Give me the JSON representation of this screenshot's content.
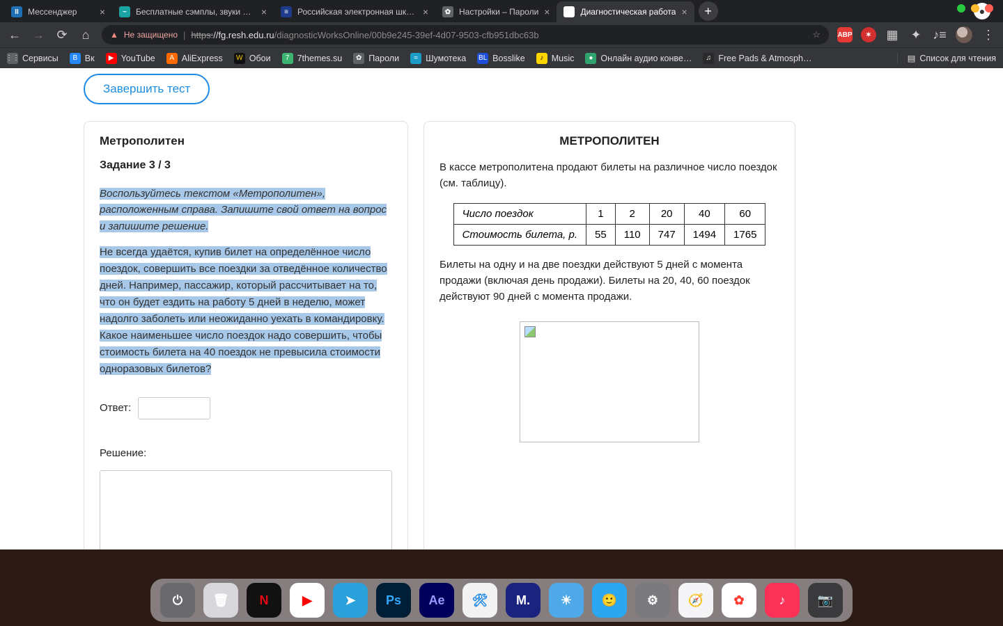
{
  "tabs": [
    {
      "title": "Мессенджер",
      "fav_bg": "#1f6fb5",
      "fav_txt": "II",
      "active": false
    },
    {
      "title": "Бесплатные сэмплы, звуки и лупы",
      "fav_bg": "#1aa3a3",
      "fav_txt": "~",
      "active": false
    },
    {
      "title": "Российская электронная школа",
      "fav_bg": "#1e3a8a",
      "fav_txt": "≡",
      "active": false
    },
    {
      "title": "Настройки – Пароли",
      "fav_bg": "#5f6368",
      "fav_txt": "✿",
      "active": false
    },
    {
      "title": "Диагностическая работа",
      "fav_bg": "#ffffff",
      "fav_txt": " ",
      "active": true
    }
  ],
  "omnibox": {
    "security_label": "Не защищено",
    "url_scheme": "https:",
    "url_domain": "//fg.resh.edu.ru",
    "url_path": "/diagnosticWorksOnline/00b9e245-39ef-4d07-9503-cfb951dbc63b"
  },
  "toolbar_ext": {
    "abp": "ABP"
  },
  "bookmarks": [
    {
      "label": "Сервисы",
      "bg": "#5f6368",
      "txt": "⋮⋮"
    },
    {
      "label": "Вк",
      "bg": "#2787f5",
      "txt": "B"
    },
    {
      "label": "YouTube",
      "bg": "#ff0000",
      "txt": "▶"
    },
    {
      "label": "AliExpress",
      "bg": "#ff6a00",
      "txt": "A"
    },
    {
      "label": "Обои",
      "bg": "#111",
      "txt": "W",
      "color": "#ffcc00"
    },
    {
      "label": "7themes.su",
      "bg": "#3cb371",
      "txt": "7"
    },
    {
      "label": "Пароли",
      "bg": "#5f6368",
      "txt": "✿"
    },
    {
      "label": "Шумотека",
      "bg": "#1a9cc7",
      "txt": "≈"
    },
    {
      "label": "Bosslike",
      "bg": "#1e4fd8",
      "txt": "BL"
    },
    {
      "label": "Music",
      "bg": "#ffd500",
      "txt": "♪",
      "color": "#000"
    },
    {
      "label": "Онлайн аудио конве…",
      "bg": "#30a46c",
      "txt": "●"
    },
    {
      "label": "Free Pads & Atmosph…",
      "bg": "#2a2a2a",
      "txt": "♫"
    }
  ],
  "reading_list": "Список для чтения",
  "page": {
    "finish": "Завершить тест",
    "left": {
      "title": "Метрополитен",
      "task": "Задание 3 / 3",
      "instruction": "Воспользуйтесь текстом «Метрополитен», расположенным справа. Запишите свой ответ на вопрос и запишите решение.",
      "para": "Не всегда удаётся, купив билет на определённое число поездок, совершить все поездки за отведённое количество дней. Например, пассажир, который рассчитывает на то, что он будет ездить на работу 5 дней в неделю, может надолго заболеть или неожиданно уехать в командировку.",
      "question": "Какое наименьшее число поездок надо совершить, чтобы стоимость билета на 40 поездок не превысила стоимости одноразовых билетов?",
      "answer_label": "Ответ:",
      "solution_label": "Решение:"
    },
    "right": {
      "title": "МЕТРОПОЛИТЕН",
      "intro": "В кассе метрополитена продают билеты на различное число поездок (см. таблицу).",
      "row1_label": "Число поездок",
      "row2_label": "Стоимость билета, р.",
      "cols": [
        "1",
        "2",
        "20",
        "40",
        "60"
      ],
      "prices": [
        "55",
        "110",
        "747",
        "1494",
        "1765"
      ],
      "footer": "Билеты на одну и на две поездки действуют 5 дней с момента продажи (включая день продажи). Билеты на 20, 40, 60 поездок действуют 90 дней с момента продажи."
    }
  },
  "dock": [
    {
      "name": "power",
      "bg": "#6a6a6e",
      "txt": "⏻"
    },
    {
      "name": "trash",
      "bg": "#d8d8dc",
      "txt": "🗑"
    },
    {
      "name": "netflix",
      "bg": "#111",
      "txt": "N",
      "color": "#e50914"
    },
    {
      "name": "youtube",
      "bg": "#fff",
      "txt": "▶",
      "color": "#ff0000"
    },
    {
      "name": "telegram",
      "bg": "#2aa1da",
      "txt": "➤"
    },
    {
      "name": "photoshop",
      "bg": "#001e36",
      "txt": "Ps",
      "color": "#31a8ff"
    },
    {
      "name": "aftereffects",
      "bg": "#00005b",
      "txt": "Ae",
      "color": "#9999ff"
    },
    {
      "name": "xcode",
      "bg": "#f2f2f2",
      "txt": "🛠",
      "color": "#1e88e5"
    },
    {
      "name": "m-app",
      "bg": "#1a237e",
      "txt": "M."
    },
    {
      "name": "weather",
      "bg": "#4fa8e8",
      "txt": "☀"
    },
    {
      "name": "finder",
      "bg": "#2aa7f0",
      "txt": "🙂"
    },
    {
      "name": "settings",
      "bg": "#7a7a7e",
      "txt": "⚙"
    },
    {
      "name": "safari",
      "bg": "#f5f5f7",
      "txt": "🧭"
    },
    {
      "name": "photos",
      "bg": "#fff",
      "txt": "✿",
      "color": "#ff3b30"
    },
    {
      "name": "music",
      "bg": "#fc3158",
      "txt": "♪"
    },
    {
      "name": "camera",
      "bg": "#3a3a3c",
      "txt": "📷"
    }
  ]
}
